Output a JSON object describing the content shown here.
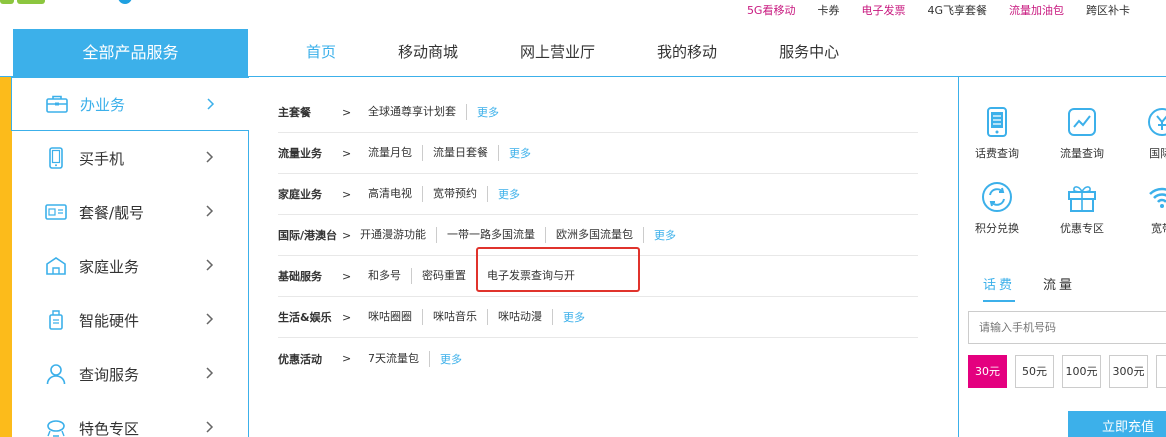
{
  "topbar": {
    "links": [
      {
        "label": "5G看移动",
        "pink": true
      },
      {
        "label": "卡券",
        "pink": false
      },
      {
        "label": "电子发票",
        "pink": true
      },
      {
        "label": "4G飞享套餐",
        "pink": false
      },
      {
        "label": "流量加油包",
        "pink": true
      },
      {
        "label": "跨区补卡",
        "pink": false
      }
    ]
  },
  "all_products": "全部产品服务",
  "nav": {
    "items": [
      "首页",
      "移动商城",
      "网上营业厅",
      "我的移动",
      "服务中心"
    ],
    "active_index": 0
  },
  "sidebar": {
    "items": [
      {
        "label": "办业务",
        "icon": "briefcase-icon"
      },
      {
        "label": "买手机",
        "icon": "phone-icon"
      },
      {
        "label": "套餐/靓号",
        "icon": "sim-card-icon"
      },
      {
        "label": "家庭业务",
        "icon": "house-icon"
      },
      {
        "label": "智能硬件",
        "icon": "device-icon"
      },
      {
        "label": "查询服务",
        "icon": "user-icon"
      },
      {
        "label": "特色专区",
        "icon": "special-icon"
      }
    ],
    "active_index": 0
  },
  "menu": {
    "separator": ">",
    "more_label": "更多",
    "rows": [
      {
        "category": "主套餐",
        "links": [
          "全球通尊享计划套"
        ],
        "more": true
      },
      {
        "category": "流量业务",
        "links": [
          "流量月包",
          "流量日套餐"
        ],
        "more": true
      },
      {
        "category": "家庭业务",
        "links": [
          "高清电视",
          "宽带预约"
        ],
        "more": true
      },
      {
        "category": "国际/港澳台",
        "links": [
          "开通漫游功能",
          "一带一路多国流量",
          "欧洲多国流量包"
        ],
        "more": true
      },
      {
        "category": "基础服务",
        "links": [
          "和多号",
          "密码重置",
          "电子发票查询与开"
        ],
        "more": false
      },
      {
        "category": "生活&娱乐",
        "links": [
          "咪咕圈圈",
          "咪咕音乐",
          "咪咕动漫"
        ],
        "more": true
      },
      {
        "category": "优惠活动",
        "links": [
          "7天流量包"
        ],
        "more": true
      }
    ]
  },
  "quick_services": [
    {
      "label": "话费查询",
      "icon": "phone-bill-icon"
    },
    {
      "label": "流量查询",
      "icon": "traffic-chart-icon"
    },
    {
      "label": "国际/",
      "icon": "international-icon"
    },
    {
      "label": "积分兑换",
      "icon": "refresh-icon"
    },
    {
      "label": "优惠专区",
      "icon": "gift-icon"
    },
    {
      "label": "宽带",
      "icon": "wifi-icon"
    }
  ],
  "recharge": {
    "tabs": [
      "话费",
      "流量"
    ],
    "active_tab": 0,
    "phone_placeholder": "请输入手机号码",
    "amounts": [
      "30元",
      "50元",
      "100元",
      "300元",
      "其"
    ],
    "selected_amount": 0,
    "button": "立即充值"
  },
  "colors": {
    "accent": "#3cb0ea",
    "pink": "#e4007f",
    "side_strip": "#fcbb1b",
    "highlight_border": "#e0332c"
  }
}
